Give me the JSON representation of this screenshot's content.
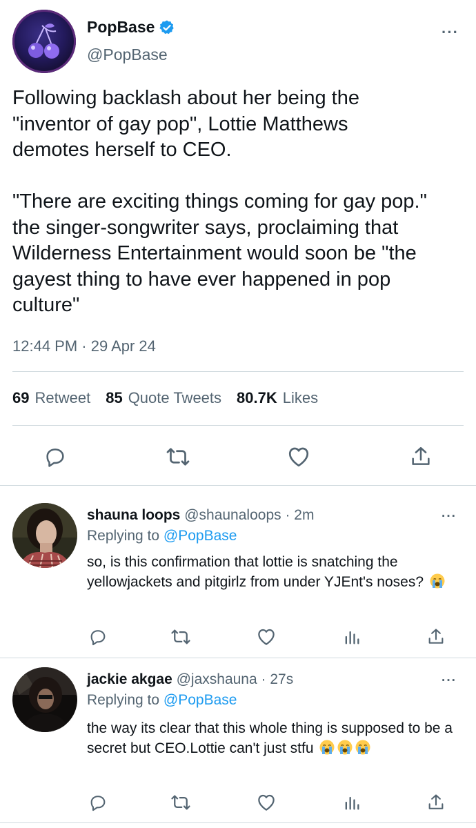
{
  "main_tweet": {
    "name": "PopBase",
    "handle": "@PopBase",
    "text": "Following backlash about her being the\n\"inventor of gay pop\", Lottie Matthews\ndemotes herself to CEO.\n\n\"There are exciting things coming for gay pop.\"\nthe singer-songwriter says, proclaiming that\nWilderness Entertainment would soon be \"the\ngayest thing to have ever happened in pop\nculture\"",
    "timestamp": "12:44 PM · 29 Apr 24",
    "stats": {
      "retweets_count": "69",
      "retweets_label": "Retweet",
      "quotes_count": "85",
      "quotes_label": "Quote Tweets",
      "likes_count": "80.7K",
      "likes_label": "Likes"
    },
    "verified_color": "#1d9bf0"
  },
  "replies": [
    {
      "name": "shauna loops",
      "handle": "@shaunaloops",
      "time": "· 2m",
      "replying_prefix": "Replying to",
      "replying_to": "@PopBase",
      "text": "so, is this confirmation that lottie is snatching the yellowjackets and pitgirlz from under YJEnt's noses?",
      "emoji": "loudly-crying-face"
    },
    {
      "name": "jackie akgae",
      "handle": "@jaxshauna",
      "time": "· 27s",
      "replying_prefix": "Replying to",
      "replying_to": "@PopBase",
      "text": "the way its clear that this whole thing is supposed to be a secret but CEO.Lottie can't just stfu",
      "emoji": "loudly-crying-face x3"
    }
  ],
  "colors": {
    "accent": "#1d9bf0",
    "text_primary": "#0f1419",
    "text_secondary": "#536471",
    "divider": "#cfd9de"
  }
}
